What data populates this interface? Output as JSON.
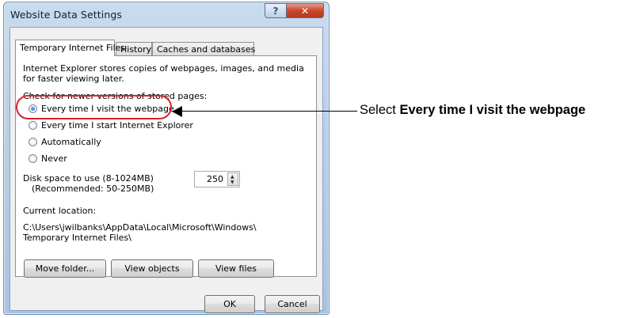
{
  "window": {
    "title": "Website Data Settings",
    "help_glyph": "?",
    "close_glyph": "✕"
  },
  "tabs": [
    {
      "label": "Temporary Internet Files",
      "active": true
    },
    {
      "label": "History",
      "active": false
    },
    {
      "label": "Caches and databases",
      "active": false
    }
  ],
  "panel": {
    "description_line1": "Internet Explorer stores copies of webpages, images, and media",
    "description_line2": "for faster viewing later.",
    "check_label": "Check for newer versions of stored pages:",
    "options": [
      {
        "label": "Every time I visit the webpage",
        "checked": true
      },
      {
        "label": "Every time I start Internet Explorer",
        "checked": false
      },
      {
        "label": "Automatically",
        "checked": false
      },
      {
        "label": "Never",
        "checked": false
      }
    ],
    "disk_label": "Disk space to use (8-1024MB)",
    "disk_recommended": "(Recommended: 50-250MB)",
    "disk_value": "250",
    "location_label": "Current location:",
    "location_line1": "C:\\Users\\jwilbanks\\AppData\\Local\\Microsoft\\Windows\\",
    "location_line2": "Temporary Internet Files\\",
    "buttons": {
      "move_folder": "Move folder...",
      "view_objects": "View objects",
      "view_files": "View files"
    }
  },
  "footer": {
    "ok": "OK",
    "cancel": "Cancel"
  },
  "annotation": {
    "prefix": "Select ",
    "bold": "Every time I visit the webpage"
  },
  "colors": {
    "highlight_ring": "#d9232e",
    "close_button": "#c9482b"
  }
}
